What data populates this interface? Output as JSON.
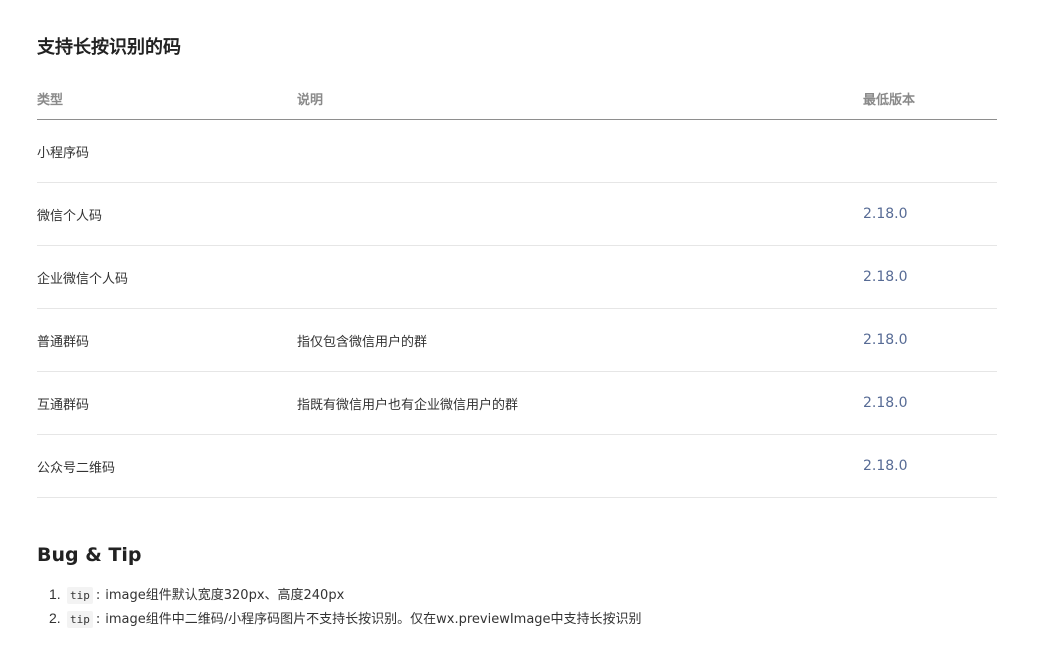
{
  "section": {
    "title": "支持长按识别的码"
  },
  "table": {
    "headers": {
      "type": "类型",
      "desc": "说明",
      "version": "最低版本"
    },
    "rows": [
      {
        "type": "小程序码",
        "desc": "",
        "version": ""
      },
      {
        "type": "微信个人码",
        "desc": "",
        "version": "2.18.0"
      },
      {
        "type": "企业微信个人码",
        "desc": "",
        "version": "2.18.0"
      },
      {
        "type": "普通群码",
        "desc": "指仅包含微信用户的群",
        "version": "2.18.0"
      },
      {
        "type": "互通群码",
        "desc": "指既有微信用户也有企业微信用户的群",
        "version": "2.18.0"
      },
      {
        "type": "公众号二维码",
        "desc": "",
        "version": "2.18.0"
      }
    ]
  },
  "bug_tip": {
    "title": "Bug & Tip",
    "items": [
      {
        "num": "1.",
        "tag": "tip",
        "sep": ":",
        "text": "image组件默认宽度320px、高度240px"
      },
      {
        "num": "2.",
        "tag": "tip",
        "sep": ":",
        "text": "image组件中二维码/小程序码图片不支持长按识别。仅在wx.previewImage中支持长按识别"
      }
    ]
  }
}
